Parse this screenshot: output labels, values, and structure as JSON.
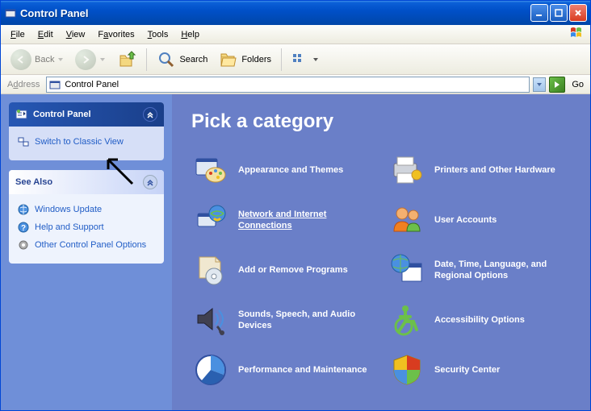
{
  "title": "Control Panel",
  "menus": [
    "File",
    "Edit",
    "View",
    "Favorites",
    "Tools",
    "Help"
  ],
  "toolbar": {
    "back": "Back",
    "search": "Search",
    "folders": "Folders"
  },
  "address": {
    "label": "Address",
    "value": "Control Panel",
    "go": "Go"
  },
  "sidebar": {
    "panel1": {
      "title": "Control Panel",
      "switch": "Switch to Classic View"
    },
    "see_also": {
      "title": "See Also",
      "items": [
        "Windows Update",
        "Help and Support",
        "Other Control Panel Options"
      ]
    }
  },
  "content": {
    "heading": "Pick a category",
    "categories": [
      "Appearance and Themes",
      "Printers and Other Hardware",
      "Network and Internet Connections",
      "User Accounts",
      "Add or Remove Programs",
      "Date, Time, Language, and Regional Options",
      "Sounds, Speech, and Audio Devices",
      "Accessibility Options",
      "Performance and Maintenance",
      "Security Center"
    ]
  }
}
